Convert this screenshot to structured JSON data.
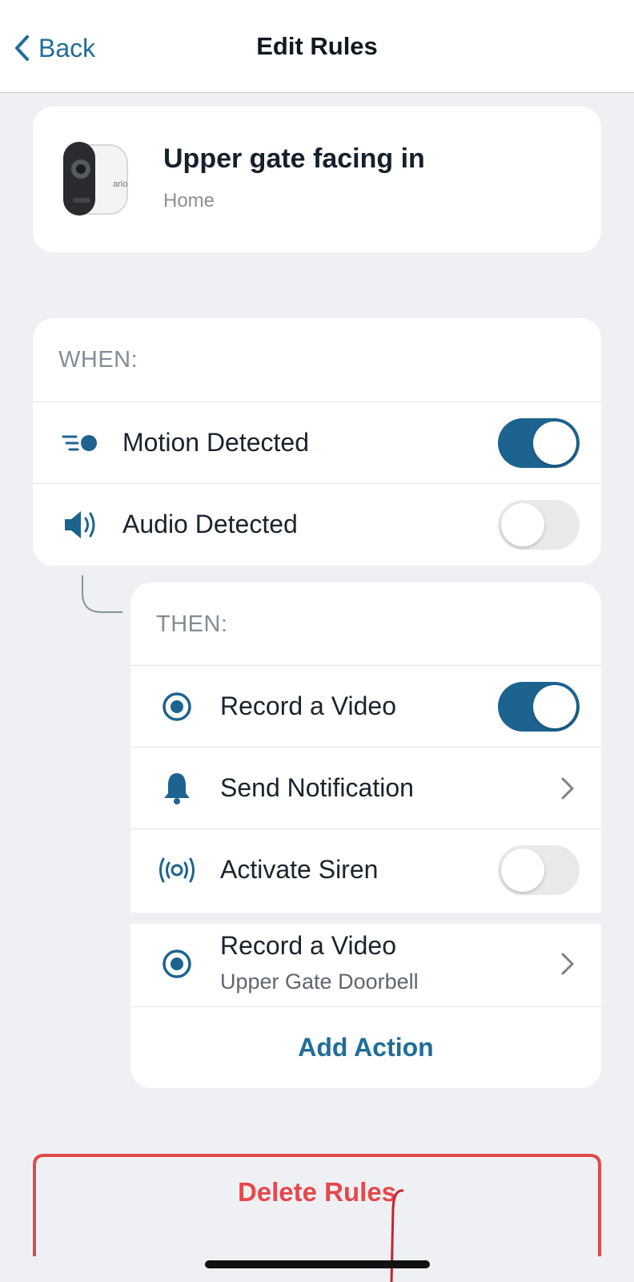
{
  "nav": {
    "back_label": "Back",
    "title": "Edit Rules"
  },
  "device": {
    "name": "Upper gate facing in",
    "location": "Home",
    "brand_mark": "arlo"
  },
  "when": {
    "heading": "WHEN:",
    "triggers": [
      {
        "label": "Motion Detected",
        "icon": "motion-icon",
        "enabled": true
      },
      {
        "label": "Audio Detected",
        "icon": "speaker-icon",
        "enabled": false
      }
    ]
  },
  "then": {
    "heading": "THEN:",
    "actions": [
      {
        "label": "Record a Video",
        "icon": "record-icon",
        "control": "toggle",
        "enabled": true
      },
      {
        "label": "Send Notification",
        "icon": "bell-icon",
        "control": "chevron"
      },
      {
        "label": "Activate Siren",
        "icon": "siren-icon",
        "control": "toggle",
        "enabled": false
      },
      {
        "label": "Record a Video",
        "sublabel": "Upper Gate Doorbell",
        "icon": "record-icon",
        "control": "chevron"
      }
    ],
    "add_action_label": "Add Action"
  },
  "delete_label": "Delete Rules",
  "colors": {
    "accent": "#1d6390",
    "link": "#1f6d98",
    "danger": "#e5484b",
    "background": "#eff0f4"
  }
}
